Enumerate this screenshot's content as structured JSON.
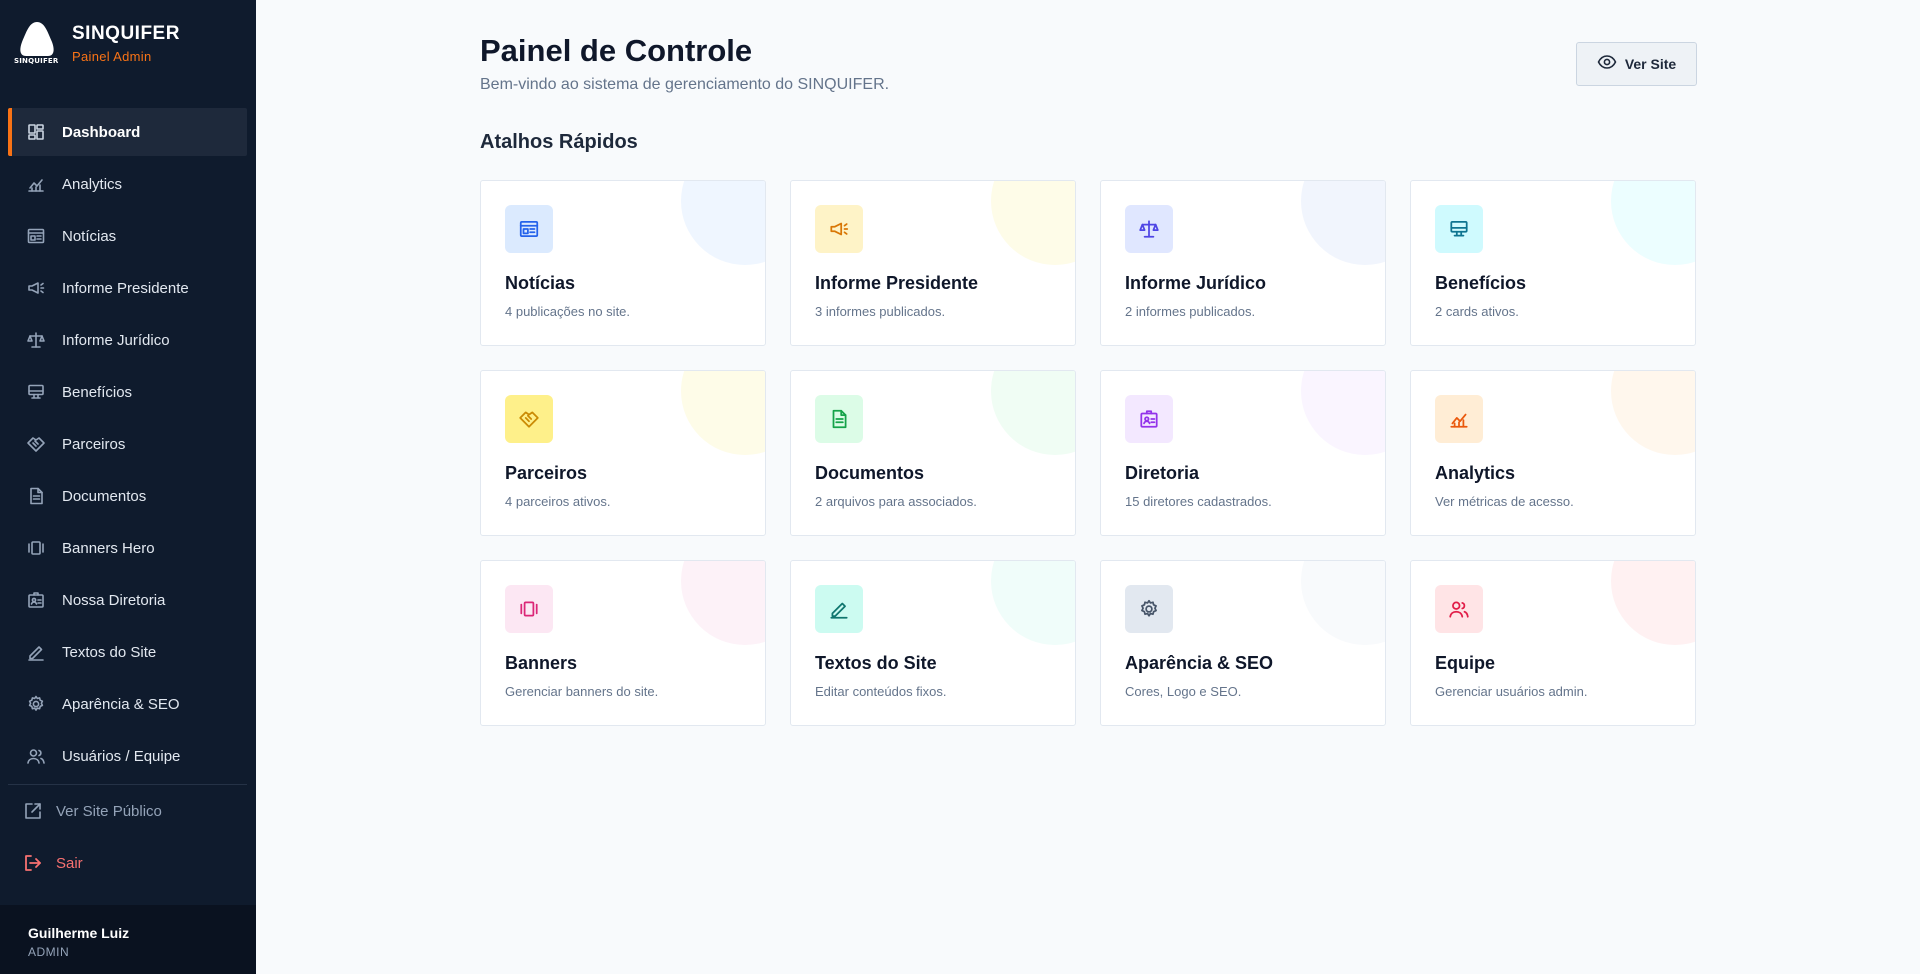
{
  "brand": {
    "name": "SINQUIFER",
    "subtitle": "Painel Admin",
    "logo_text": "SINQUIFER"
  },
  "sidebar": {
    "items": [
      {
        "label": "Dashboard",
        "icon": "dashboard-icon",
        "active": true
      },
      {
        "label": "Analytics",
        "icon": "chart-icon"
      },
      {
        "label": "Notícias",
        "icon": "newspaper-icon"
      },
      {
        "label": "Informe Presidente",
        "icon": "megaphone-icon"
      },
      {
        "label": "Informe Jurídico",
        "icon": "scale-icon"
      },
      {
        "label": "Benefícios",
        "icon": "monitor-icon"
      },
      {
        "label": "Parceiros",
        "icon": "handshake-icon"
      },
      {
        "label": "Documentos",
        "icon": "document-icon"
      },
      {
        "label": "Banners Hero",
        "icon": "carousel-icon"
      },
      {
        "label": "Nossa Diretoria",
        "icon": "id-card-icon"
      },
      {
        "label": "Textos do Site",
        "icon": "pen-icon"
      },
      {
        "label": "Aparência & SEO",
        "icon": "gear-icon"
      },
      {
        "label": "Usuários / Equipe",
        "icon": "users-icon"
      }
    ],
    "public_site_label": "Ver Site Público",
    "logout_label": "Sair"
  },
  "user": {
    "name": "Guilherme Luiz",
    "role": "ADMIN"
  },
  "header": {
    "title": "Painel de Controle",
    "subtitle": "Bem-vindo ao sistema de gerenciamento do SINQUIFER.",
    "view_site_label": "Ver Site"
  },
  "shortcuts": {
    "title": "Atalhos Rápidos",
    "cards": [
      {
        "title": "Notícias",
        "desc": "4 publicações no site.",
        "icon": "newspaper-icon",
        "bg": "#dbeafe",
        "fg": "#2563eb",
        "deco": "#eff6ff"
      },
      {
        "title": "Informe Presidente",
        "desc": "3 informes publicados.",
        "icon": "megaphone-icon",
        "bg": "#fef3c7",
        "fg": "#d97706",
        "deco": "#fefce8"
      },
      {
        "title": "Informe Jurídico",
        "desc": "2 informes publicados.",
        "icon": "scale-icon",
        "bg": "#e0e7ff",
        "fg": "#4f46e5",
        "deco": "#f1f5fd"
      },
      {
        "title": "Benefícios",
        "desc": "2 cards ativos.",
        "icon": "monitor-icon",
        "bg": "#cffafe",
        "fg": "#0e7490",
        "deco": "#ecfeff"
      },
      {
        "title": "Parceiros",
        "desc": "4 parceiros ativos.",
        "icon": "handshake-icon",
        "bg": "#fef08a",
        "fg": "#ca8a04",
        "deco": "#fefce8"
      },
      {
        "title": "Documentos",
        "desc": "2 arquivos para associados.",
        "icon": "document-icon",
        "bg": "#dcfce7",
        "fg": "#16a34a",
        "deco": "#f0fdf4"
      },
      {
        "title": "Diretoria",
        "desc": "15 diretores cadastrados.",
        "icon": "id-card-icon",
        "bg": "#f3e8ff",
        "fg": "#9333ea",
        "deco": "#faf5ff"
      },
      {
        "title": "Analytics",
        "desc": "Ver métricas de acesso.",
        "icon": "chart-icon",
        "bg": "#ffedd5",
        "fg": "#ea580c",
        "deco": "#fff7ed"
      },
      {
        "title": "Banners",
        "desc": "Gerenciar banners do site.",
        "icon": "carousel-icon",
        "bg": "#fce7f3",
        "fg": "#db2777",
        "deco": "#fdf2f8"
      },
      {
        "title": "Textos do Site",
        "desc": "Editar conteúdos fixos.",
        "icon": "pen-icon",
        "bg": "#ccfbf1",
        "fg": "#0f766e",
        "deco": "#f0fdfa"
      },
      {
        "title": "Aparência & SEO",
        "desc": "Cores, Logo e SEO.",
        "icon": "gear-icon",
        "bg": "#e2e8f0",
        "fg": "#475569",
        "deco": "#f8fafc"
      },
      {
        "title": "Equipe",
        "desc": "Gerenciar usuários admin.",
        "icon": "users-icon",
        "bg": "#ffe4e6",
        "fg": "#e11d48",
        "deco": "#fff1f2"
      }
    ]
  }
}
